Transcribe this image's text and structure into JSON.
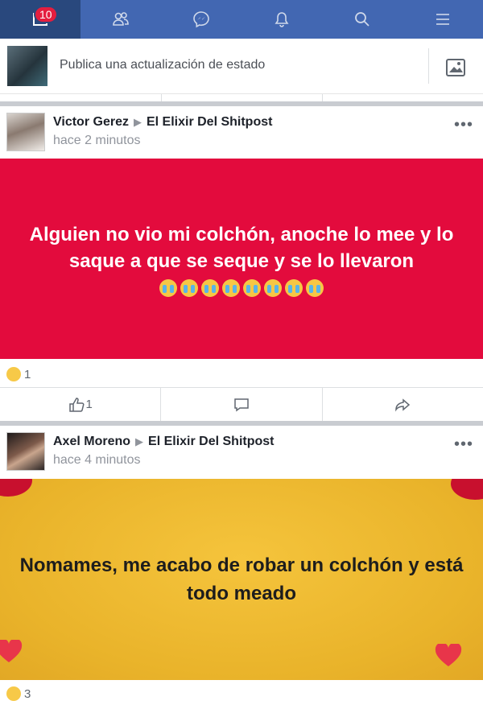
{
  "nav": {
    "badge_count": "10",
    "items": [
      "home-icon",
      "friends-icon",
      "messenger-icon",
      "notifications-icon",
      "search-icon",
      "menu-icon"
    ]
  },
  "composer": {
    "placeholder": "Publica una actualización de estado"
  },
  "posts": [
    {
      "author": "Victor Gerez",
      "group": "El Elixir Del Shitpost",
      "time": "hace 2 minutos",
      "text": "Alguien no vio mi colchón, anoche lo mee y lo saque a que se seque y se lo llevaron",
      "emoji_count": 8,
      "background": "#e30b3d",
      "reaction_count": "1",
      "like_count": "1"
    },
    {
      "author": "Axel Moreno",
      "group": "El Elixir Del Shitpost",
      "time": "hace 4 minutos",
      "text": "Nomames, me acabo de robar un colchón y está todo meado",
      "background": "#f5c43c",
      "reaction_count": "3"
    }
  ],
  "colors": {
    "nav_bg": "#4267b2",
    "nav_active": "#29487d",
    "badge": "#e41e3f"
  }
}
